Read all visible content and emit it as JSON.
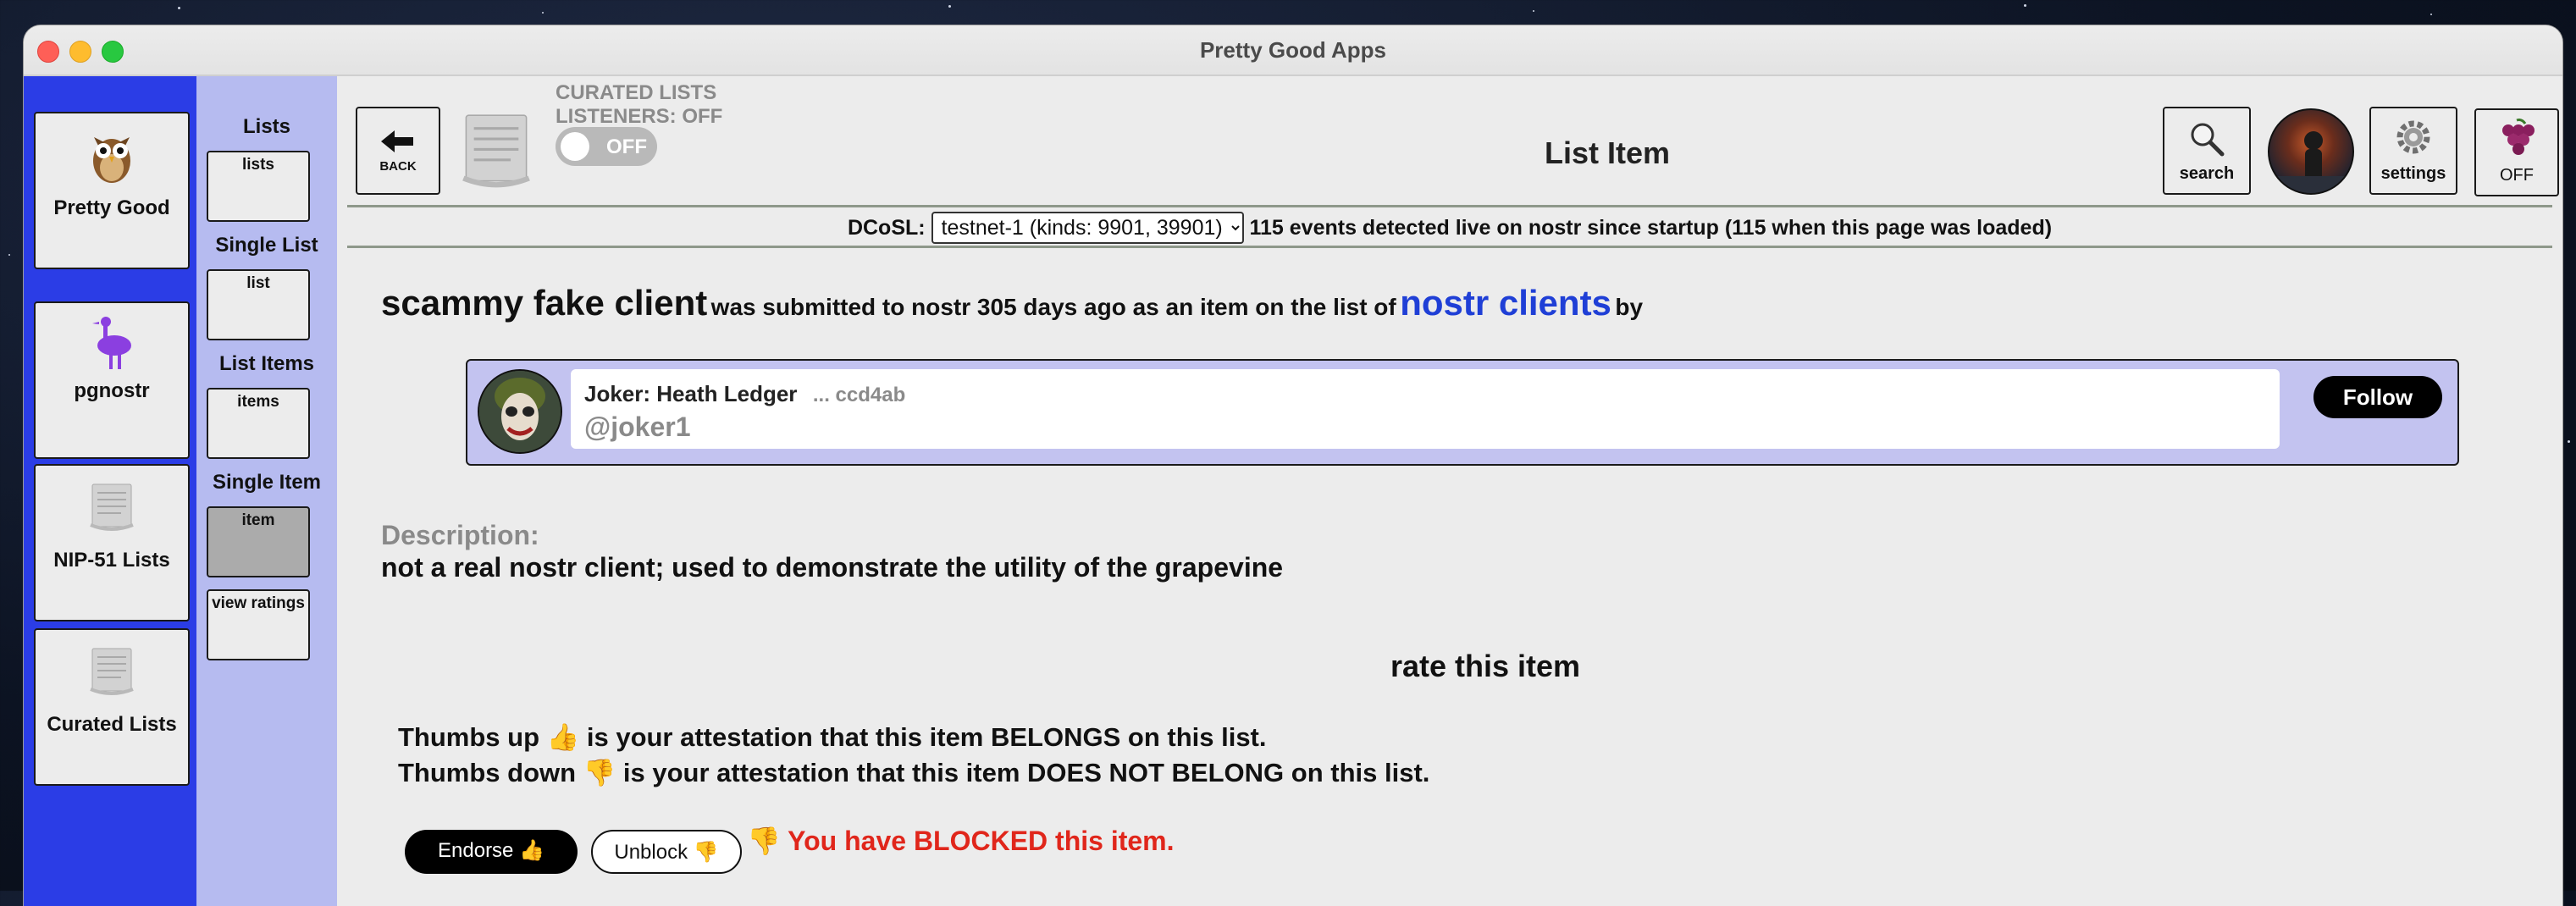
{
  "window": {
    "title": "Pretty Good Apps"
  },
  "sidebar": {
    "apps": [
      {
        "label": "Pretty Good",
        "icon": "owl-icon"
      },
      {
        "label": "pgnostr",
        "icon": "ostrich-icon"
      },
      {
        "label": "NIP-51 Lists",
        "icon": "scroll-icon"
      },
      {
        "label": "Curated Lists",
        "icon": "scroll-icon"
      }
    ]
  },
  "subnav": {
    "sections": [
      {
        "heading": "Lists",
        "tile": "lists"
      },
      {
        "heading": "Single List",
        "tile": "list"
      },
      {
        "heading": "List Items",
        "tile": "items"
      },
      {
        "heading": "Single Item",
        "tile": "item"
      }
    ],
    "extra_tile": "view ratings",
    "active_tile": "item"
  },
  "header": {
    "back_label": "BACK",
    "curated_line1": "CURATED LISTS",
    "curated_line2": "LISTENERS: OFF",
    "toggle_label": "OFF",
    "page_title": "List Item",
    "search_label": "search",
    "settings_label": "settings",
    "grapevine_label": "OFF"
  },
  "dcosl": {
    "label": "DCoSL:",
    "selected": "testnet-1 (kinds: 9901, 39901)",
    "status": "115 events detected live on nostr since startup (115 when this page was loaded)"
  },
  "item": {
    "name": "scammy fake client",
    "mid_text": "was submitted to nostr 305 days ago as an item on the list of",
    "list_name": "nostr clients",
    "by_text": "by"
  },
  "author": {
    "display_name": "Joker: Heath Ledger",
    "pubkey_short": "... ccd4ab",
    "handle": "@joker1",
    "follow_label": "Follow"
  },
  "description": {
    "label": "Description:",
    "text": "not a real nostr client; used to demonstrate the utility of the grapevine"
  },
  "rating": {
    "heading": "rate this item",
    "line1": "Thumbs up 👍 is your attestation that this item BELONGS on this list.",
    "line2": "Thumbs down 👎 is your attestation that this item DOES NOT BELONG on this list.",
    "endorse_label": "Endorse 👍",
    "unblock_label": "Unblock 👎",
    "status": "👎 You have BLOCKED this item."
  },
  "colors": {
    "sidebar": "#2b3de6",
    "subnav": "#b6bbf0",
    "list_link": "#1f3fd6",
    "blocked": "#e0261b",
    "card": "#c3c3f0"
  }
}
